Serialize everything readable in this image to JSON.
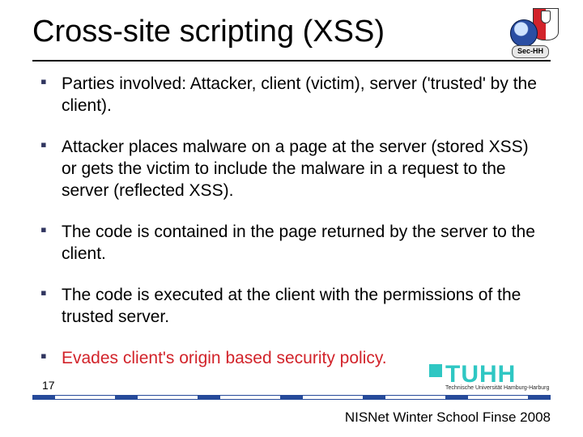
{
  "title": "Cross-site scripting (XSS)",
  "bullets": [
    {
      "text": "Parties involved: Attacker, client (victim), server ('trusted' by the client).",
      "emphasis": false
    },
    {
      "text": "Attacker places malware on a page at the server (stored XSS) or gets the victim to include the malware in a request to the server (reflected XSS).",
      "emphasis": false
    },
    {
      "text": "The code is contained in the page returned by the server to the client.",
      "emphasis": false
    },
    {
      "text": "The code is executed at the client with the permissions of the trusted server.",
      "emphasis": false
    },
    {
      "text": "Evades client's origin based security policy.",
      "emphasis": true
    }
  ],
  "page_number": "17",
  "footer": "NISNet Winter School Finse 2008",
  "logo_top": {
    "badge_text": "Sec-HH"
  },
  "logo_bottom": {
    "word": "TUHH",
    "sub": "Technische Universität Hamburg-Harburg"
  }
}
